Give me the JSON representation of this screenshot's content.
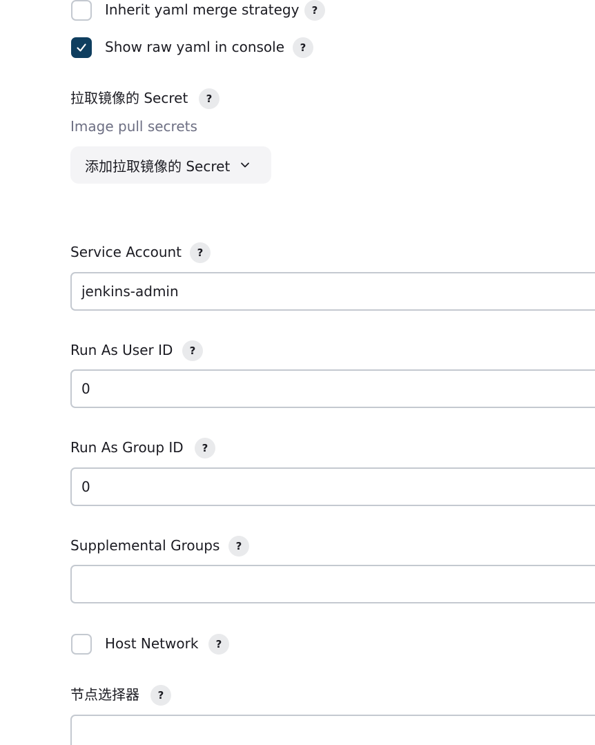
{
  "inherit_yaml": {
    "label": "Inherit yaml merge strategy",
    "checked": false,
    "help": "?"
  },
  "show_raw_yaml": {
    "label": "Show raw yaml in console",
    "checked": true,
    "help": "?"
  },
  "image_pull_secret": {
    "label": "拉取镜像的 Secret",
    "sublabel": "Image pull secrets",
    "add_button_label": "添加拉取镜像的 Secret",
    "help": "?"
  },
  "service_account": {
    "label": "Service Account",
    "value": "jenkins-admin",
    "help": "?"
  },
  "run_as_user_id": {
    "label": "Run As User ID",
    "value": "0",
    "help": "?"
  },
  "run_as_group_id": {
    "label": "Run As Group ID",
    "value": "0",
    "help": "?"
  },
  "supplemental_groups": {
    "label": "Supplemental Groups",
    "value": "",
    "help": "?"
  },
  "host_network": {
    "label": "Host Network",
    "checked": false,
    "help": "?"
  },
  "node_selector": {
    "label": "节点选择器",
    "value": "",
    "help": "?"
  },
  "colors": {
    "accent": "#0f3e5f",
    "border": "#c4c9d0",
    "help_bg": "#e9eaec",
    "muted_text": "#6d6f83"
  },
  "icons": {
    "checkbox_check": "check-icon",
    "dropdown": "chevron-down-icon",
    "help": "help-icon"
  }
}
